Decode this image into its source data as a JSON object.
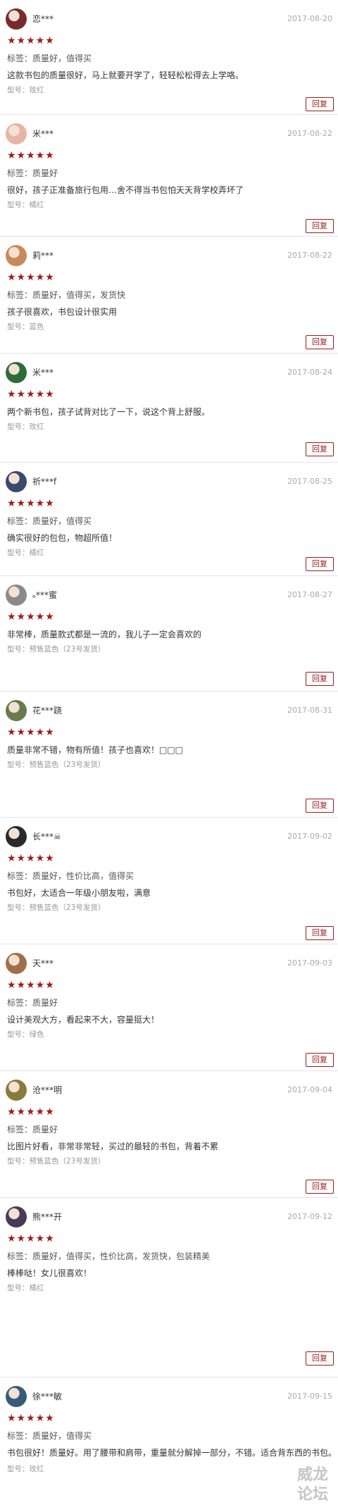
{
  "reviews": [
    {
      "username": "恋***",
      "date": "2017-08-20",
      "stars": "★★★★★",
      "tags": "标签：质量好，值得买",
      "text": "这款书包的质量很好，马上就要开学了，轻轻松松得去上学咯。",
      "model": "型号：玫红",
      "reply_label": "回复",
      "avatar_color": "#7a2a2a"
    },
    {
      "username": "米***",
      "date": "2017-08-22",
      "stars": "★★★★★",
      "tags": "标签：质量好",
      "text": "很好，孩子正准备旅行包用…舍不得当书包怕天天背学校弄坏了",
      "model": "型号：橘红",
      "reply_label": "回复",
      "avatar_color": "#e8b4a6"
    },
    {
      "username": "莉***",
      "date": "2017-08-22",
      "stars": "★★★★★",
      "tags": "标签：质量好，值得买，发货快",
      "text": "孩子很喜欢，书包设计很实用",
      "model": "型号：蓝色",
      "reply_label": "回复",
      "avatar_color": "#c98a5a"
    },
    {
      "username": "米***",
      "date": "2017-08-24",
      "stars": "★★★★★",
      "tags": "",
      "text": "两个新书包，孩子试背对比了一下，说这个背上舒服。",
      "model": "型号：玫红",
      "reply_label": "回复",
      "avatar_color": "#2e6b3a"
    },
    {
      "username": "祈***f",
      "date": "2017-08-25",
      "stars": "★★★★★",
      "tags": "标签：质量好，值得买",
      "text": "确实很好的包包，物超所值！",
      "model": "型号：橘红",
      "reply_label": "回复",
      "avatar_color": "#3a4a6a"
    },
    {
      "username": "ₒ***蜜",
      "date": "2017-08-27",
      "stars": "★★★★★",
      "tags": "",
      "text": "非常棒，质量款式都是一流的，我儿子一定会喜欢的",
      "model": "型号：预售蓝色（23号发货）",
      "reply_label": "回复",
      "avatar_color": "#8a8a8a"
    },
    {
      "username": "花***跷",
      "date": "2017-08-31",
      "stars": "★★★★★",
      "tags": "",
      "text": "质量非常不错，物有所值！孩子也喜欢！□□□",
      "model": "型号：预售蓝色（23号发货）",
      "reply_label": "回复",
      "avatar_color": "#6a7a4a"
    },
    {
      "username": "长***☠",
      "date": "2017-09-02",
      "stars": "★★★★★",
      "tags": "标签：质量好，性价比高，值得买",
      "text": "书包好，太适合一年级小朋友啦，满意",
      "model": "型号：预售蓝色（23号发货）",
      "reply_label": "回复",
      "avatar_color": "#2a2a2a"
    },
    {
      "username": "天***",
      "date": "2017-09-03",
      "stars": "★★★★★",
      "tags": "标签：质量好",
      "text": "设计美观大方，看起来不大，容量挺大！",
      "model": "型号：绿色",
      "reply_label": "回复",
      "avatar_color": "#a0704a"
    },
    {
      "username": "沧***明",
      "date": "2017-09-04",
      "stars": "★★★★★",
      "tags": "标签：质量好",
      "text": "比图片好看，非常非常轻，买过的最轻的书包，背着不累",
      "model": "型号：预售蓝色（23号发货）",
      "reply_label": "回复",
      "avatar_color": "#8a7a3a"
    },
    {
      "username": "熊***开",
      "date": "2017-09-12",
      "stars": "★★★★★",
      "tags": "标签：质量好，值得买，性价比高，发货快，包装精美",
      "text": "棒棒哒！女儿很喜欢！",
      "model": "型号：橘红",
      "reply_label": "回复",
      "avatar_color": "#4a3a5a"
    },
    {
      "username": "徐***敏",
      "date": "2017-09-15",
      "stars": "★★★★★",
      "tags": "标签：质量好，值得买",
      "text": "书包很好！质量好。用了腰带和肩带，重量就分解掉一部分，不错。适合背东西的书包。",
      "model": "型号：玫红",
      "reply_label": "回复",
      "avatar_color": "#3a5a7a"
    }
  ],
  "watermark": {
    "line1": "威龙",
    "line2": "论坛"
  }
}
